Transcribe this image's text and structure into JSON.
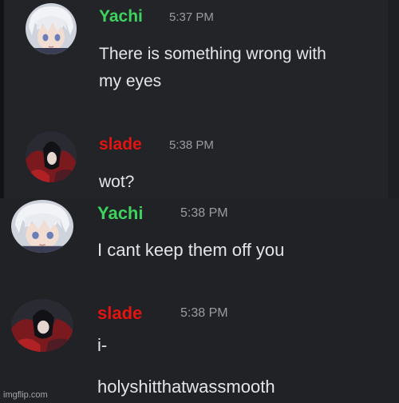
{
  "colors": {
    "background": "#1e1f22",
    "yachi_name": "#3ed35f",
    "slade_name": "#e3140f",
    "message_text": "#e3e5e8",
    "timestamp": "#9a9ca2"
  },
  "messages": [
    {
      "author": "Yachi",
      "time": "5:37 PM",
      "avatar": "white-haired-anime-avatar",
      "lines": [
        "There is something wrong with",
        "my eyes"
      ]
    },
    {
      "author": "slade",
      "time": "5:38 PM",
      "avatar": "dark-red-cloak-avatar",
      "lines": [
        "wot?"
      ]
    },
    {
      "author": "Yachi",
      "time": "5:38 PM",
      "avatar": "white-haired-anime-avatar",
      "lines": [
        "I cant keep them off you"
      ]
    },
    {
      "author": "slade",
      "time": "5:38 PM",
      "avatar": "dark-red-cloak-avatar",
      "lines": [
        "i-",
        "holyshitthatwassmooth"
      ]
    }
  ],
  "watermark": "imgflip.com"
}
